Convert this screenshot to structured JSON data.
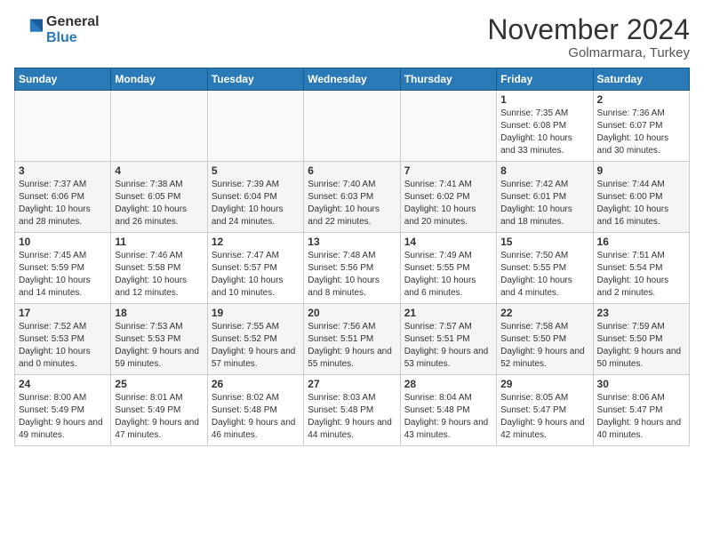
{
  "header": {
    "logo_general": "General",
    "logo_blue": "Blue",
    "month": "November 2024",
    "location": "Golmarmara, Turkey"
  },
  "weekdays": [
    "Sunday",
    "Monday",
    "Tuesday",
    "Wednesday",
    "Thursday",
    "Friday",
    "Saturday"
  ],
  "weeks": [
    [
      {
        "day": "",
        "info": ""
      },
      {
        "day": "",
        "info": ""
      },
      {
        "day": "",
        "info": ""
      },
      {
        "day": "",
        "info": ""
      },
      {
        "day": "",
        "info": ""
      },
      {
        "day": "1",
        "info": "Sunrise: 7:35 AM\nSunset: 6:08 PM\nDaylight: 10 hours and 33 minutes."
      },
      {
        "day": "2",
        "info": "Sunrise: 7:36 AM\nSunset: 6:07 PM\nDaylight: 10 hours and 30 minutes."
      }
    ],
    [
      {
        "day": "3",
        "info": "Sunrise: 7:37 AM\nSunset: 6:06 PM\nDaylight: 10 hours and 28 minutes."
      },
      {
        "day": "4",
        "info": "Sunrise: 7:38 AM\nSunset: 6:05 PM\nDaylight: 10 hours and 26 minutes."
      },
      {
        "day": "5",
        "info": "Sunrise: 7:39 AM\nSunset: 6:04 PM\nDaylight: 10 hours and 24 minutes."
      },
      {
        "day": "6",
        "info": "Sunrise: 7:40 AM\nSunset: 6:03 PM\nDaylight: 10 hours and 22 minutes."
      },
      {
        "day": "7",
        "info": "Sunrise: 7:41 AM\nSunset: 6:02 PM\nDaylight: 10 hours and 20 minutes."
      },
      {
        "day": "8",
        "info": "Sunrise: 7:42 AM\nSunset: 6:01 PM\nDaylight: 10 hours and 18 minutes."
      },
      {
        "day": "9",
        "info": "Sunrise: 7:44 AM\nSunset: 6:00 PM\nDaylight: 10 hours and 16 minutes."
      }
    ],
    [
      {
        "day": "10",
        "info": "Sunrise: 7:45 AM\nSunset: 5:59 PM\nDaylight: 10 hours and 14 minutes."
      },
      {
        "day": "11",
        "info": "Sunrise: 7:46 AM\nSunset: 5:58 PM\nDaylight: 10 hours and 12 minutes."
      },
      {
        "day": "12",
        "info": "Sunrise: 7:47 AM\nSunset: 5:57 PM\nDaylight: 10 hours and 10 minutes."
      },
      {
        "day": "13",
        "info": "Sunrise: 7:48 AM\nSunset: 5:56 PM\nDaylight: 10 hours and 8 minutes."
      },
      {
        "day": "14",
        "info": "Sunrise: 7:49 AM\nSunset: 5:55 PM\nDaylight: 10 hours and 6 minutes."
      },
      {
        "day": "15",
        "info": "Sunrise: 7:50 AM\nSunset: 5:55 PM\nDaylight: 10 hours and 4 minutes."
      },
      {
        "day": "16",
        "info": "Sunrise: 7:51 AM\nSunset: 5:54 PM\nDaylight: 10 hours and 2 minutes."
      }
    ],
    [
      {
        "day": "17",
        "info": "Sunrise: 7:52 AM\nSunset: 5:53 PM\nDaylight: 10 hours and 0 minutes."
      },
      {
        "day": "18",
        "info": "Sunrise: 7:53 AM\nSunset: 5:53 PM\nDaylight: 9 hours and 59 minutes."
      },
      {
        "day": "19",
        "info": "Sunrise: 7:55 AM\nSunset: 5:52 PM\nDaylight: 9 hours and 57 minutes."
      },
      {
        "day": "20",
        "info": "Sunrise: 7:56 AM\nSunset: 5:51 PM\nDaylight: 9 hours and 55 minutes."
      },
      {
        "day": "21",
        "info": "Sunrise: 7:57 AM\nSunset: 5:51 PM\nDaylight: 9 hours and 53 minutes."
      },
      {
        "day": "22",
        "info": "Sunrise: 7:58 AM\nSunset: 5:50 PM\nDaylight: 9 hours and 52 minutes."
      },
      {
        "day": "23",
        "info": "Sunrise: 7:59 AM\nSunset: 5:50 PM\nDaylight: 9 hours and 50 minutes."
      }
    ],
    [
      {
        "day": "24",
        "info": "Sunrise: 8:00 AM\nSunset: 5:49 PM\nDaylight: 9 hours and 49 minutes."
      },
      {
        "day": "25",
        "info": "Sunrise: 8:01 AM\nSunset: 5:49 PM\nDaylight: 9 hours and 47 minutes."
      },
      {
        "day": "26",
        "info": "Sunrise: 8:02 AM\nSunset: 5:48 PM\nDaylight: 9 hours and 46 minutes."
      },
      {
        "day": "27",
        "info": "Sunrise: 8:03 AM\nSunset: 5:48 PM\nDaylight: 9 hours and 44 minutes."
      },
      {
        "day": "28",
        "info": "Sunrise: 8:04 AM\nSunset: 5:48 PM\nDaylight: 9 hours and 43 minutes."
      },
      {
        "day": "29",
        "info": "Sunrise: 8:05 AM\nSunset: 5:47 PM\nDaylight: 9 hours and 42 minutes."
      },
      {
        "day": "30",
        "info": "Sunrise: 8:06 AM\nSunset: 5:47 PM\nDaylight: 9 hours and 40 minutes."
      }
    ]
  ]
}
